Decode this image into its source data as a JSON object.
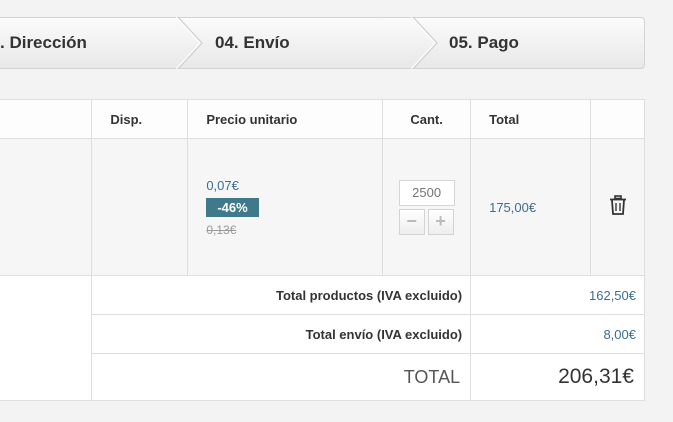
{
  "steps": [
    {
      "label": ". Dirección"
    },
    {
      "label": "04. Envío"
    },
    {
      "label": "05. Pago"
    }
  ],
  "table": {
    "headers": {
      "availability": "Disp.",
      "unit_price": "Precio unitario",
      "quantity": "Cant.",
      "total": "Total"
    },
    "product": {
      "price_new": "0,07€",
      "discount": "-46%",
      "price_old": "0,13€",
      "quantity_placeholder": "2500",
      "minus_label": "−",
      "plus_label": "+",
      "line_total": "175,00€",
      "delete_icon": "trash-icon"
    },
    "summary": {
      "products_label": "Total productos (IVA excluido)",
      "products_value": "162,50€",
      "shipping_label": "Total envío (IVA excluido)",
      "shipping_value": "8,00€",
      "total_label": "TOTAL",
      "total_value": "206,31€"
    }
  },
  "colors": {
    "accent": "#3b6e8f",
    "discount_badge": "#3f7a8c"
  }
}
